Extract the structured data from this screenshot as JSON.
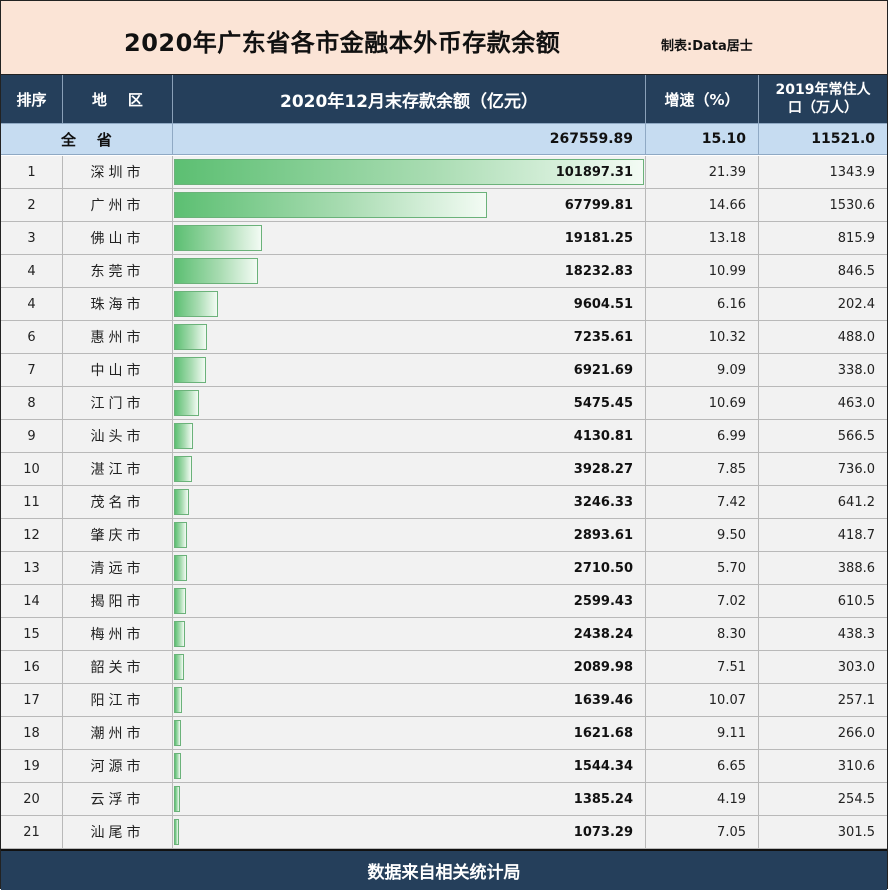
{
  "title": "2020年广东省各市金融本外币存款余额",
  "maker": "制表:Data居士",
  "header": {
    "rank": "排序",
    "region": "地    区",
    "balance": "2020年12月末存款余额（亿元）",
    "growth": "增速（%）",
    "pop_line1": "2019年常住人",
    "pop_line2": "口（万人）"
  },
  "total": {
    "label": "全    省",
    "balance": "267559.89",
    "growth": "15.10",
    "population": "11521.0"
  },
  "rows": [
    {
      "rank": "1",
      "region": "深圳市",
      "balance": "101897.31",
      "growth": "21.39",
      "population": "1343.9",
      "value": 101897.31
    },
    {
      "rank": "2",
      "region": "广州市",
      "balance": "67799.81",
      "growth": "14.66",
      "population": "1530.6",
      "value": 67799.81
    },
    {
      "rank": "3",
      "region": "佛山市",
      "balance": "19181.25",
      "growth": "13.18",
      "population": "815.9",
      "value": 19181.25
    },
    {
      "rank": "4",
      "region": "东莞市",
      "balance": "18232.83",
      "growth": "10.99",
      "population": "846.5",
      "value": 18232.83
    },
    {
      "rank": "4",
      "region": "珠海市",
      "balance": "9604.51",
      "growth": "6.16",
      "population": "202.4",
      "value": 9604.51
    },
    {
      "rank": "6",
      "region": "惠州市",
      "balance": "7235.61",
      "growth": "10.32",
      "population": "488.0",
      "value": 7235.61
    },
    {
      "rank": "7",
      "region": "中山市",
      "balance": "6921.69",
      "growth": "9.09",
      "population": "338.0",
      "value": 6921.69
    },
    {
      "rank": "8",
      "region": "江门市",
      "balance": "5475.45",
      "growth": "10.69",
      "population": "463.0",
      "value": 5475.45
    },
    {
      "rank": "9",
      "region": "汕头市",
      "balance": "4130.81",
      "growth": "6.99",
      "population": "566.5",
      "value": 4130.81
    },
    {
      "rank": "10",
      "region": "湛江市",
      "balance": "3928.27",
      "growth": "7.85",
      "population": "736.0",
      "value": 3928.27
    },
    {
      "rank": "11",
      "region": "茂名市",
      "balance": "3246.33",
      "growth": "7.42",
      "population": "641.2",
      "value": 3246.33
    },
    {
      "rank": "12",
      "region": "肇庆市",
      "balance": "2893.61",
      "growth": "9.50",
      "population": "418.7",
      "value": 2893.61
    },
    {
      "rank": "13",
      "region": "清远市",
      "balance": "2710.50",
      "growth": "5.70",
      "population": "388.6",
      "value": 2710.5
    },
    {
      "rank": "14",
      "region": "揭阳市",
      "balance": "2599.43",
      "growth": "7.02",
      "population": "610.5",
      "value": 2599.43
    },
    {
      "rank": "15",
      "region": "梅州市",
      "balance": "2438.24",
      "growth": "8.30",
      "population": "438.3",
      "value": 2438.24
    },
    {
      "rank": "16",
      "region": "韶关市",
      "balance": "2089.98",
      "growth": "7.51",
      "population": "303.0",
      "value": 2089.98
    },
    {
      "rank": "17",
      "region": "阳江市",
      "balance": "1639.46",
      "growth": "10.07",
      "population": "257.1",
      "value": 1639.46
    },
    {
      "rank": "18",
      "region": "潮州市",
      "balance": "1621.68",
      "growth": "9.11",
      "population": "266.0",
      "value": 1621.68
    },
    {
      "rank": "19",
      "region": "河源市",
      "balance": "1544.34",
      "growth": "6.65",
      "population": "310.6",
      "value": 1544.34
    },
    {
      "rank": "20",
      "region": "云浮市",
      "balance": "1385.24",
      "growth": "4.19",
      "population": "254.5",
      "value": 1385.24
    },
    {
      "rank": "21",
      "region": "汕尾市",
      "balance": "1073.29",
      "growth": "7.05",
      "population": "301.5",
      "value": 1073.29
    }
  ],
  "footer": "数据来自相关统计局",
  "colors": {
    "header_bg": "#253f5b",
    "title_bg": "#fbe4d6",
    "total_bg": "#c6dcf1",
    "bar_green": "#5cbf72"
  }
}
